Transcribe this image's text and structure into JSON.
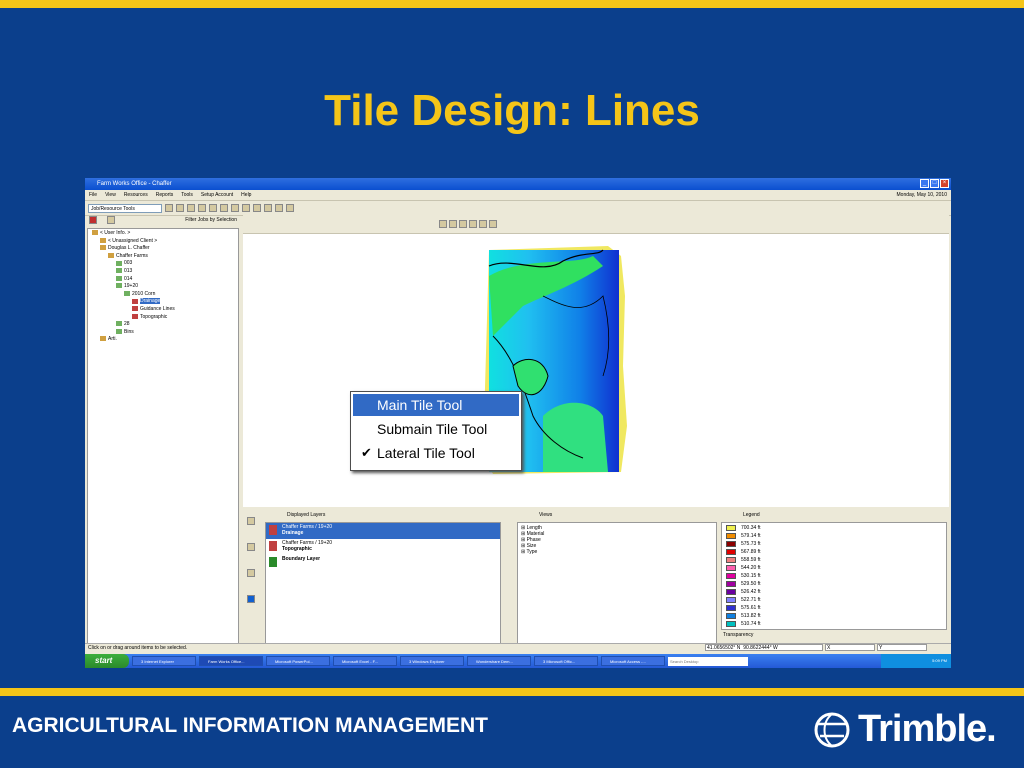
{
  "slide": {
    "title": "Tile Design:  Lines",
    "footer": "AGRICULTURAL INFORMATION MANAGEMENT",
    "logo_text": "Trimble.",
    "colors": {
      "background": "#0b3f8c",
      "accent": "#f5c518"
    }
  },
  "app": {
    "window_title": "Farm Works Office - Chaffer",
    "menus": [
      "File",
      "View",
      "Resources",
      "Reports",
      "Tools",
      "Setup Account",
      "Help"
    ],
    "date": "Monday, May 10, 2010",
    "toolbar_combo": "Job/Resource Tools",
    "filter_label": "Filter Jobs by Selection",
    "tree": [
      {
        "label": "< User Info. >",
        "level": 0
      },
      {
        "label": "< Unassigned Client >",
        "level": 1
      },
      {
        "label": "Douglas L. Chaffer",
        "level": 1
      },
      {
        "label": "Chaffer Farms",
        "level": 2
      },
      {
        "label": "003",
        "level": 3
      },
      {
        "label": "013",
        "level": 3
      },
      {
        "label": "014",
        "level": 3
      },
      {
        "label": "19+20",
        "level": 3
      },
      {
        "label": "2010 Corn",
        "level": 4
      },
      {
        "label": "Drainage",
        "level": 5,
        "selected": true
      },
      {
        "label": "Guidance Lines",
        "level": 5
      },
      {
        "label": "Topographic",
        "level": 5
      },
      {
        "label": "28",
        "level": 3
      },
      {
        "label": "Bins",
        "level": 3
      },
      {
        "label": "Arti.",
        "level": 1
      }
    ],
    "dropdown": {
      "items": [
        {
          "label": "Main Tile Tool",
          "highlighted": true,
          "checked": false
        },
        {
          "label": "Submain Tile Tool",
          "highlighted": false,
          "checked": false
        },
        {
          "label": "Lateral Tile Tool",
          "highlighted": false,
          "checked": true
        }
      ]
    },
    "panels": {
      "displayed_layers": {
        "title": "Displayed Layers",
        "items": [
          {
            "line1": "Chaffer Farms / 19+20",
            "line2": "Drainage",
            "selected": true
          },
          {
            "line1": "Chaffer Farms / 19+20",
            "line2": "Topographic",
            "selected": false
          },
          {
            "line1": "",
            "line2": "Boundary Layer",
            "selected": false
          }
        ]
      },
      "views": {
        "title": "Views",
        "items": [
          "Length",
          "Material",
          "Phase",
          "Size",
          "Type"
        ]
      },
      "legend": {
        "title": "Legend",
        "transparency_label": "Transparency",
        "items": [
          {
            "label": "700.34 ft",
            "color": "#f0f050"
          },
          {
            "label": "579.14 ft",
            "color": "#f08c00"
          },
          {
            "label": "575.73 ft",
            "color": "#8b0000"
          },
          {
            "label": "567.89 ft",
            "color": "#e00000"
          },
          {
            "label": "558.59 ft",
            "color": "#f08080"
          },
          {
            "label": "544.20 ft",
            "color": "#ff60b0"
          },
          {
            "label": "530.15 ft",
            "color": "#e000a0"
          },
          {
            "label": "529.50 ft",
            "color": "#a000a0"
          },
          {
            "label": "526.42 ft",
            "color": "#6a00a0"
          },
          {
            "label": "522.71 ft",
            "color": "#8080ff"
          },
          {
            "label": "575.61 ft",
            "color": "#3030d0"
          },
          {
            "label": "513.82 ft",
            "color": "#1080e0"
          },
          {
            "label": "510.74 ft",
            "color": "#00c0c0"
          }
        ]
      }
    },
    "status": "Click on or drag around items to be selected.",
    "coords": {
      "lat": "41.0656502° N",
      "lon": "90.8622444° W",
      "x": "X",
      "y": "Y"
    },
    "taskbar": {
      "start": "start",
      "tasks": [
        {
          "label": "3 Internet Explorer",
          "active": false
        },
        {
          "label": "Farm Works Office...",
          "active": true
        },
        {
          "label": "Microsoft PowerPoi...",
          "active": false
        },
        {
          "label": "Microsoft Excel - F...",
          "active": false
        },
        {
          "label": "3 Windows Explorer",
          "active": false
        },
        {
          "label": "Wondershare Dem...",
          "active": false
        },
        {
          "label": "3 Microsoft Offic...",
          "active": false
        },
        {
          "label": "Microsoft Access -...",
          "active": false
        }
      ],
      "search": "Search Desktop",
      "clock": "5:09 PM"
    }
  }
}
